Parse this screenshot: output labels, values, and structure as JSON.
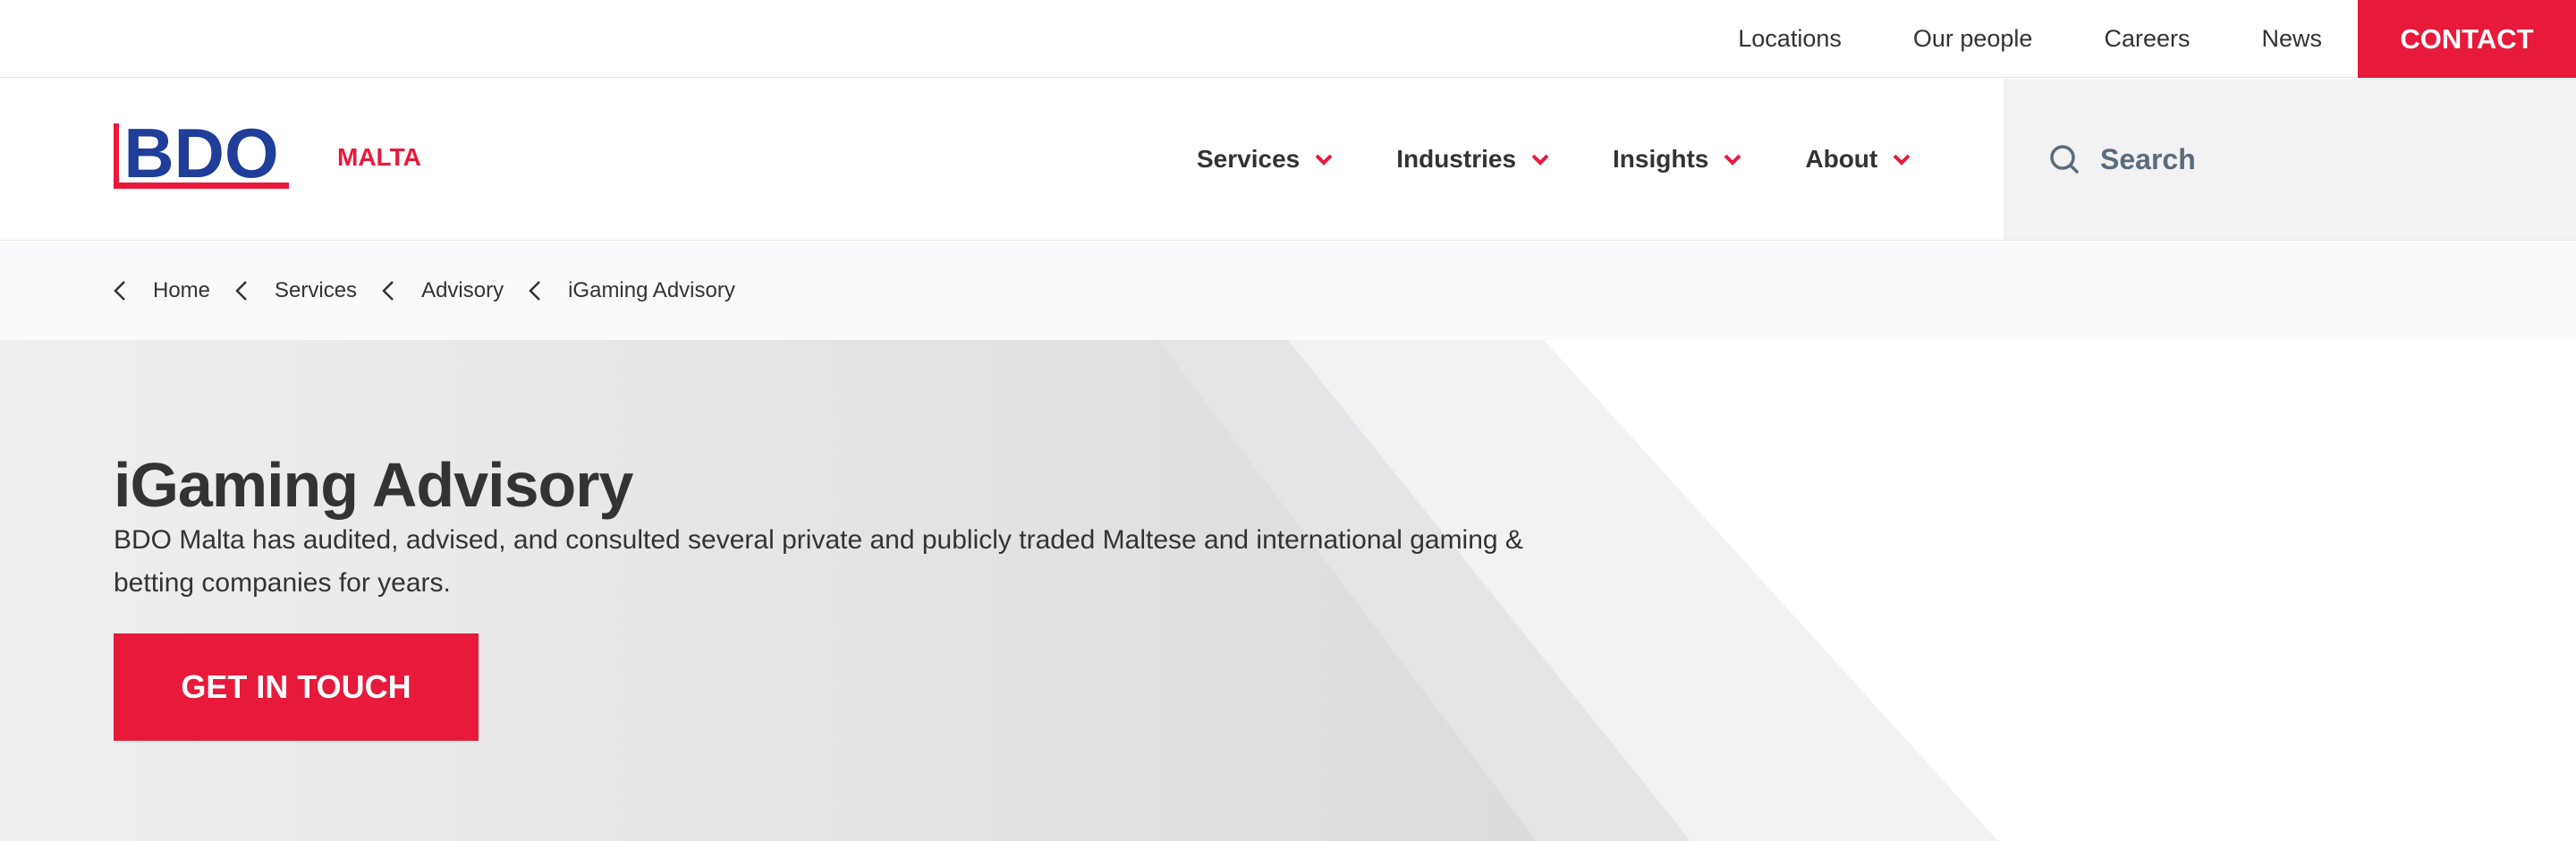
{
  "utility_nav": {
    "items": [
      "Locations",
      "Our people",
      "Careers",
      "News"
    ],
    "contact_label": "CONTACT"
  },
  "brand": {
    "logo_text": "BDO",
    "region": "MALTA",
    "logo_color": "#1f3d99",
    "accent_color": "#e81a3b"
  },
  "main_nav": {
    "items": [
      {
        "label": "Services",
        "icon": "chevron-down-icon"
      },
      {
        "label": "Industries",
        "icon": "chevron-down-icon"
      },
      {
        "label": "Insights",
        "icon": "chevron-down-icon"
      },
      {
        "label": "About",
        "icon": "chevron-down-icon"
      }
    ]
  },
  "search": {
    "placeholder": "Search",
    "icon": "search-icon"
  },
  "breadcrumb": {
    "items": [
      "Home",
      "Services",
      "Advisory"
    ],
    "current": "iGaming Advisory"
  },
  "hero": {
    "title": "iGaming Advisory",
    "description": "BDO Malta has audited, advised, and consulted several private and publicly traded Maltese and international gaming & betting companies for years.",
    "cta_label": "GET IN TOUCH"
  }
}
